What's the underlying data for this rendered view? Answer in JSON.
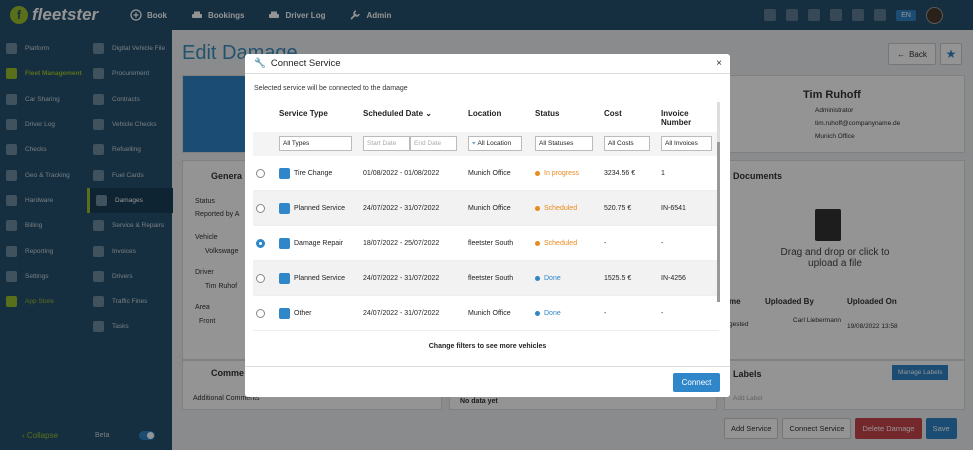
{
  "topbar": {
    "logo": "fleetster",
    "nav": [
      {
        "label": "Book",
        "icon": "plus-circle-icon"
      },
      {
        "label": "Bookings",
        "icon": "car-icon"
      },
      {
        "label": "Driver Log",
        "icon": "car-icon"
      },
      {
        "label": "Admin",
        "icon": "wrench-icon"
      }
    ],
    "lang": "EN"
  },
  "sidebar": {
    "left": [
      {
        "label": "Platform"
      },
      {
        "label": "Fleet Management",
        "active": true
      },
      {
        "label": "Car Sharing"
      },
      {
        "label": "Driver Log"
      },
      {
        "label": "Checks"
      },
      {
        "label": "Geo & Tracking"
      },
      {
        "label": "Hardware"
      },
      {
        "label": "Billing"
      },
      {
        "label": "Reporting"
      },
      {
        "label": "Settings"
      },
      {
        "label": "App Store",
        "green": true
      }
    ],
    "right": [
      {
        "label": "Digital Vehicle File"
      },
      {
        "label": "Procurement"
      },
      {
        "label": "Contracts"
      },
      {
        "label": "Vehicle Checks"
      },
      {
        "label": "Refuelling"
      },
      {
        "label": "Fuel Cards"
      },
      {
        "label": "Damages",
        "selected": true
      },
      {
        "label": "Service & Repairs"
      },
      {
        "label": "Invoices"
      },
      {
        "label": "Drivers"
      },
      {
        "label": "Traffic Fines"
      },
      {
        "label": "Tasks"
      }
    ],
    "collapse": "Collapse",
    "beta": "Beta"
  },
  "page": {
    "title": "Edit Damage",
    "back": "Back",
    "general": "Genera",
    "status_label": "Status",
    "status_value": "Reported by A",
    "vehicle_label": "Vehicle",
    "vehicle_value": "Volkswage",
    "driver_label": "Driver",
    "driver_value": "Tim Ruhof",
    "area_label": "Area",
    "area_value": "Front",
    "comments": "Comme",
    "additional_comments": "Additional Comments",
    "no_data": "No data yet",
    "documents": "Documents",
    "drag_drop": "Drag and drop or click to upload a file",
    "labels": "Labels",
    "manage_labels": "Manage Labels",
    "add_label": "Add Label",
    "docs_headers": {
      "name": "me",
      "uploaded_by": "Uploaded By",
      "uploaded_on": "Uploaded On"
    },
    "doc_row": {
      "name": "gested",
      "by": "Carl Liebermann",
      "on": "19/08/2022 13:58"
    },
    "profile": {
      "name": "Tim Ruhoff",
      "role": "Administrator",
      "email": "tim.ruhoff@companyname.de",
      "office": "Munich Office"
    }
  },
  "actions": {
    "add_service": "Add Service",
    "connect_service": "Connect Service",
    "delete": "Delete Damage",
    "save": "Save"
  },
  "modal": {
    "title": "Connect Service",
    "subtitle": "Selected service will be connected to the damage",
    "close": "×",
    "headers": {
      "type": "Service Type",
      "date": "Scheduled Date",
      "location": "Location",
      "status": "Status",
      "cost": "Cost",
      "invoice": "Invoice Number"
    },
    "filters": {
      "type": "All Types",
      "start": "Start Date",
      "end": "End Date",
      "location": "All Location",
      "status": "All Statuses",
      "cost": "All Costs",
      "invoice": "All Invoices"
    },
    "rows": [
      {
        "type": "Tire Change",
        "icon": "tire-icon",
        "date": "01/08/2022 - 01/08/2022",
        "location": "Munich Office",
        "status": "In progress",
        "status_color": "#e98b1c",
        "cost": "3234.56 €",
        "invoice": "1",
        "selected": false
      },
      {
        "type": "Planned Service",
        "icon": "car-service-icon",
        "date": "24/07/2022 - 31/07/2022",
        "location": "Munich Office",
        "status": "Scheduled",
        "status_color": "#e98b1c",
        "cost": "520.75 €",
        "invoice": "IN-6541",
        "selected": false
      },
      {
        "type": "Damage Repair",
        "icon": "car-crash-icon",
        "date": "18/07/2022 - 25/07/2022",
        "location": "fleetster South",
        "status": "Scheduled",
        "status_color": "#e98b1c",
        "cost": "-",
        "invoice": "-",
        "selected": true
      },
      {
        "type": "Planned Service",
        "icon": "car-service-icon",
        "date": "24/07/2022 - 31/07/2022",
        "location": "fleetster South",
        "status": "Done",
        "status_color": "#2f86c9",
        "cost": "1525.5 €",
        "invoice": "IN-4256",
        "selected": false
      },
      {
        "type": "Other",
        "icon": "clipboard-check-icon",
        "date": "24/07/2022 - 31/07/2022",
        "location": "Munich Office",
        "status": "Done",
        "status_color": "#2f86c9",
        "cost": "-",
        "invoice": "-",
        "selected": false
      }
    ],
    "more": "Change filters to see more vehicles",
    "connect": "Connect"
  }
}
